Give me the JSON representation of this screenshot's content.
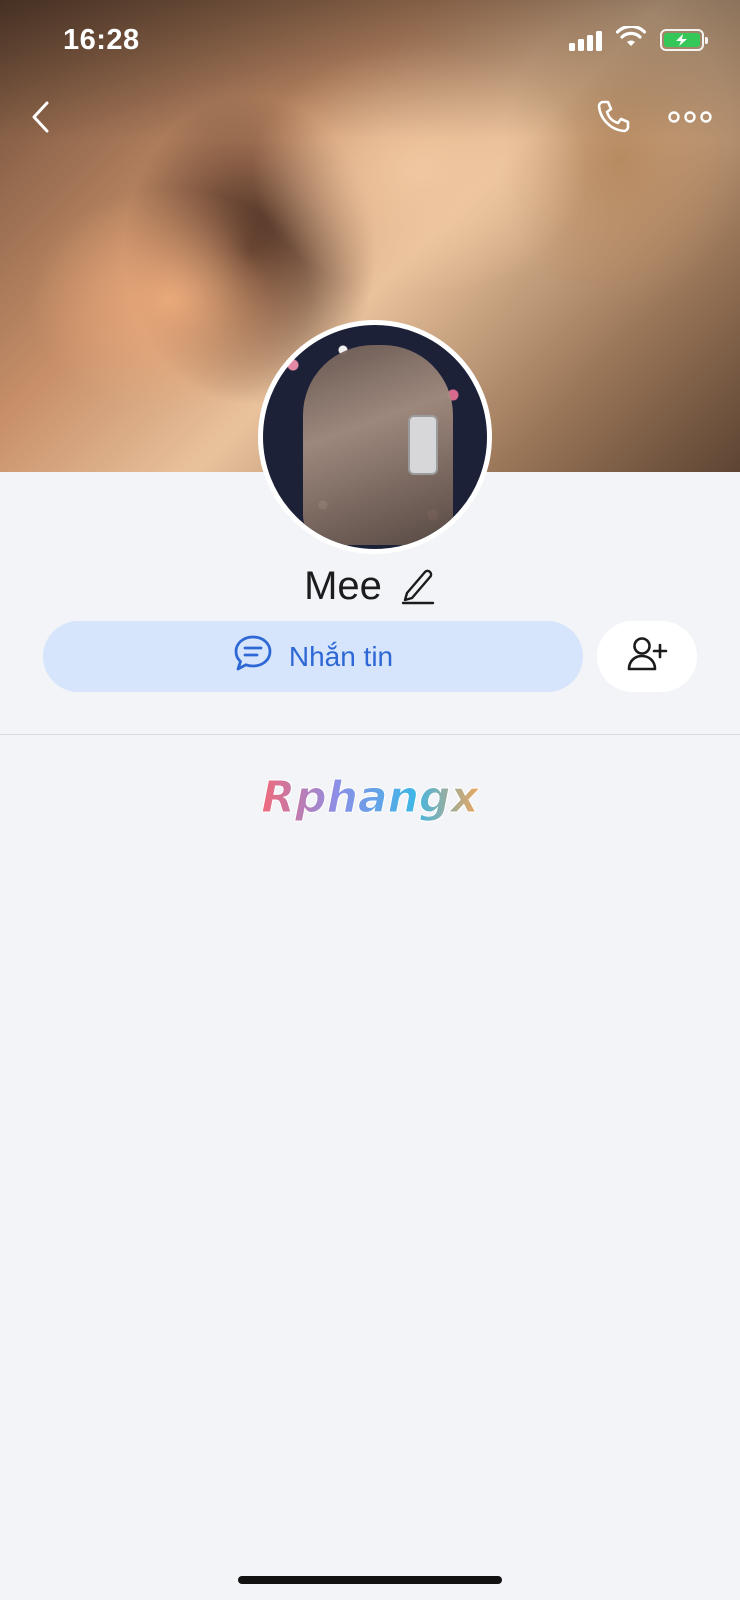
{
  "status_bar": {
    "time": "16:28",
    "icons": [
      "signal-icon",
      "wifi-icon",
      "battery-charging-icon"
    ],
    "battery_color": "#36c759"
  },
  "header": {
    "back_icon": "chevron-left-icon",
    "call_icon": "phone-icon",
    "more_icon": "more-dots-icon"
  },
  "profile": {
    "name": "Mee",
    "edit_icon": "pencil-icon"
  },
  "actions": {
    "message_label": "Nhắn tin",
    "message_icon": "chat-bubble-icon",
    "add_friend_icon": "add-friend-icon",
    "accent_color": "#2e68d6",
    "message_bg": "#d6e5fb"
  },
  "watermark": {
    "text": "Rphangx"
  }
}
